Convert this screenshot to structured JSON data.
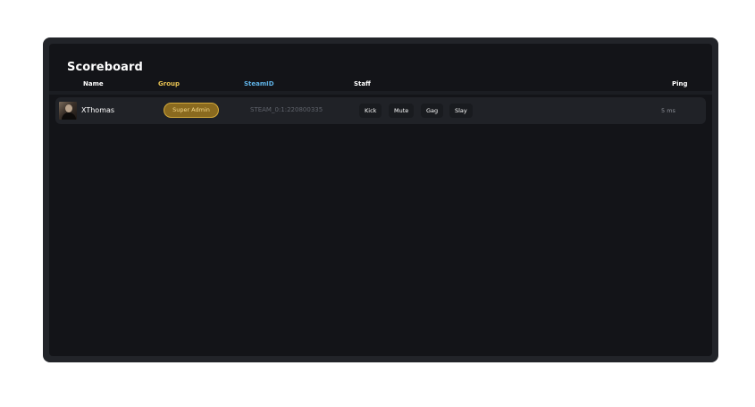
{
  "scoreboard": {
    "title": "Scoreboard",
    "columns": {
      "name": "Name",
      "group": "Group",
      "steamid": "SteamID",
      "staff": "Staff",
      "ping": "Ping"
    },
    "colors": {
      "name_header": "#ffffff",
      "group_header": "#e8c252",
      "steamid_header": "#5fb3e8",
      "staff_header": "#ffffff",
      "ping_header": "#ffffff",
      "badge_gold": "#8a6a1f"
    },
    "players": [
      {
        "name": "XThomas",
        "group": "Super Admin",
        "steamid": "STEAM_0:1:220800335",
        "actions": [
          "Kick",
          "Mute",
          "Gag",
          "Slay"
        ],
        "ping": "5 ms"
      }
    ]
  }
}
